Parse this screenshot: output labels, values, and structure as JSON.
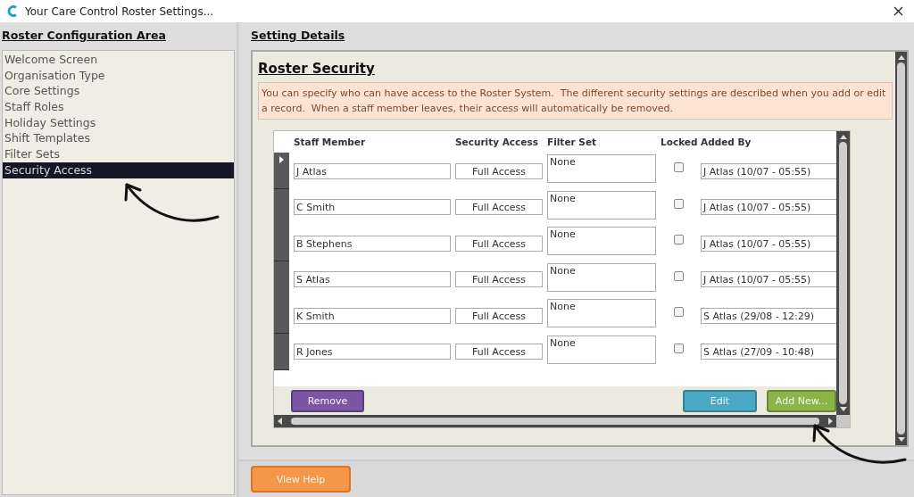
{
  "window": {
    "title": "Your Care Control Roster Settings..."
  },
  "sidebar": {
    "heading": "Roster Configuration Area",
    "items": [
      {
        "label": "Welcome Screen",
        "selected": false
      },
      {
        "label": "Organisation Type",
        "selected": false
      },
      {
        "label": "Core Settings",
        "selected": false
      },
      {
        "label": "Staff Roles",
        "selected": false
      },
      {
        "label": "Holiday Settings",
        "selected": false
      },
      {
        "label": "Shift Templates",
        "selected": false
      },
      {
        "label": "Filter Sets",
        "selected": false
      },
      {
        "label": "Security Access",
        "selected": true
      }
    ]
  },
  "details": {
    "heading": "Setting Details",
    "section_title": "Roster Security",
    "notice": "You can specify who can have access to the Roster System.  The different security settings are described when you add or edit a record.  When a staff member leaves, their access will automatically be removed.",
    "table": {
      "columns": [
        "Staff Member",
        "Security Access",
        "Filter Set",
        "Locked",
        "Added By"
      ],
      "rows": [
        {
          "staff_member": "J Atlas",
          "security_access": "Full Access",
          "filter_set": "None",
          "locked": false,
          "added_by": "J Atlas (10/07 - 05:55)",
          "current": true
        },
        {
          "staff_member": "C Smith",
          "security_access": "Full Access",
          "filter_set": "None",
          "locked": false,
          "added_by": "J Atlas (10/07 - 05:55)",
          "current": false
        },
        {
          "staff_member": "B Stephens",
          "security_access": "Full Access",
          "filter_set": "None",
          "locked": false,
          "added_by": "J Atlas (10/07 - 05:55)",
          "current": false
        },
        {
          "staff_member": "S Atlas",
          "security_access": "Full Access",
          "filter_set": "None",
          "locked": false,
          "added_by": "J Atlas (10/07 - 05:55)",
          "current": false
        },
        {
          "staff_member": "K Smith",
          "security_access": "Full Access",
          "filter_set": "None",
          "locked": false,
          "added_by": "S Atlas (29/08 - 12:29)",
          "current": false
        },
        {
          "staff_member": "R Jones",
          "security_access": "Full Access",
          "filter_set": "None",
          "locked": false,
          "added_by": "S Atlas (27/09 - 10:48)",
          "current": false
        }
      ]
    },
    "buttons": [
      {
        "label": "Remove",
        "kind": "remove"
      },
      {
        "label": "Edit",
        "kind": "edit"
      },
      {
        "label": "Add New...",
        "kind": "add"
      }
    ]
  },
  "footer": {
    "button": "View Help"
  }
}
